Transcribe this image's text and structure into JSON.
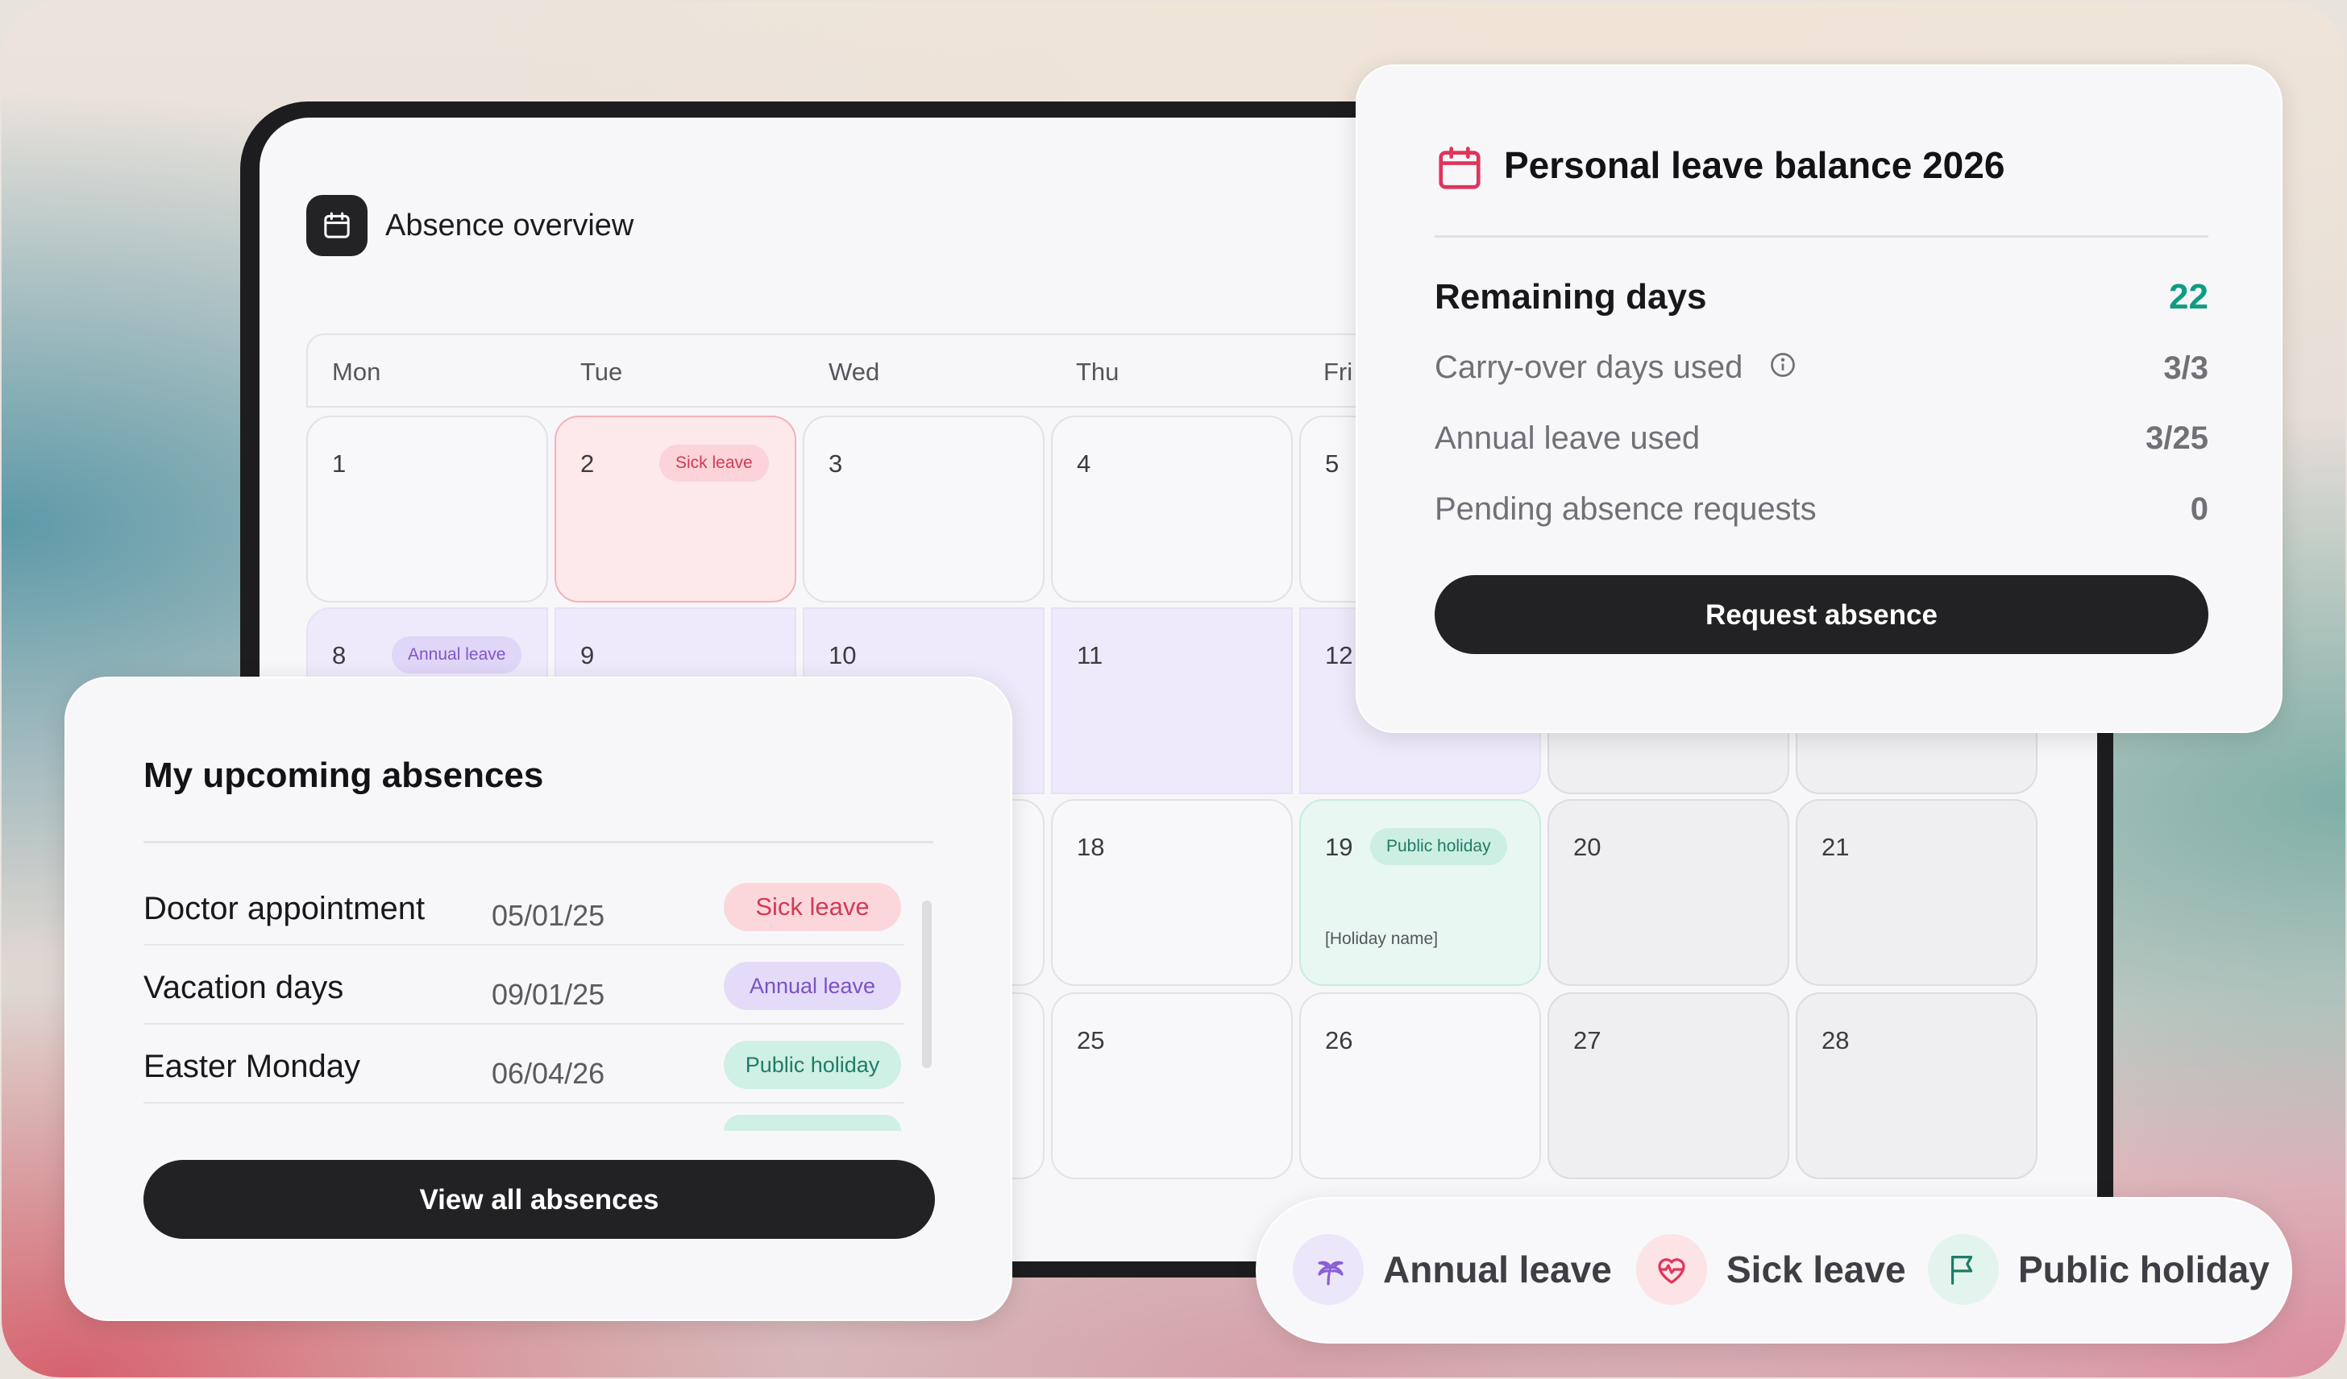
{
  "overview": {
    "title": "Absence overview",
    "weekdays": [
      "Mon",
      "Tue",
      "Wed",
      "Thu",
      "Fri"
    ],
    "days": {
      "d1": "1",
      "d2": "2",
      "d3": "3",
      "d4": "4",
      "d5": "5",
      "d8": "8",
      "d9": "9",
      "d10": "10",
      "d11": "11",
      "d12": "12",
      "d18": "18",
      "d19": "19",
      "d20": "20",
      "d21": "21",
      "d25": "25",
      "d26": "26",
      "d27": "27",
      "d28": "28"
    },
    "tags": {
      "sick": "Sick leave",
      "annual": "Annual leave",
      "holiday": "Public holiday"
    },
    "holiday_name": "[Holiday name]"
  },
  "balance": {
    "title": "Personal leave balance 2026",
    "remaining_label": "Remaining days",
    "remaining_value": "22",
    "carryover_label": "Carry-over days used",
    "carryover_value": "3/3",
    "annual_label": "Annual leave used",
    "annual_value": "3/25",
    "pending_label": "Pending absence requests",
    "pending_value": "0",
    "request_button": "Request absence"
  },
  "upcoming": {
    "title": "My upcoming absences",
    "rows": [
      {
        "name": "Doctor appointment",
        "date": "05/01/25",
        "tag": "Sick leave"
      },
      {
        "name": "Vacation days",
        "date": "09/01/25",
        "tag": "Annual leave"
      },
      {
        "name": "Easter Monday",
        "date": "06/04/26",
        "tag": "Public holiday"
      }
    ],
    "view_all_button": "View all absences"
  },
  "legend": {
    "annual": "Annual leave",
    "sick": "Sick leave",
    "holiday": "Public holiday"
  },
  "colors": {
    "sick": "#d23a53",
    "annual": "#8056c9",
    "holiday": "#1f7c66",
    "accent_green": "#0f9c84",
    "dark_button": "#222224"
  },
  "icons": {
    "overview": "calendar-icon",
    "balance": "calendar-icon",
    "info": "info-icon",
    "annual": "palm-tree-icon",
    "sick": "heart-pulse-icon",
    "holiday": "flag-icon"
  }
}
